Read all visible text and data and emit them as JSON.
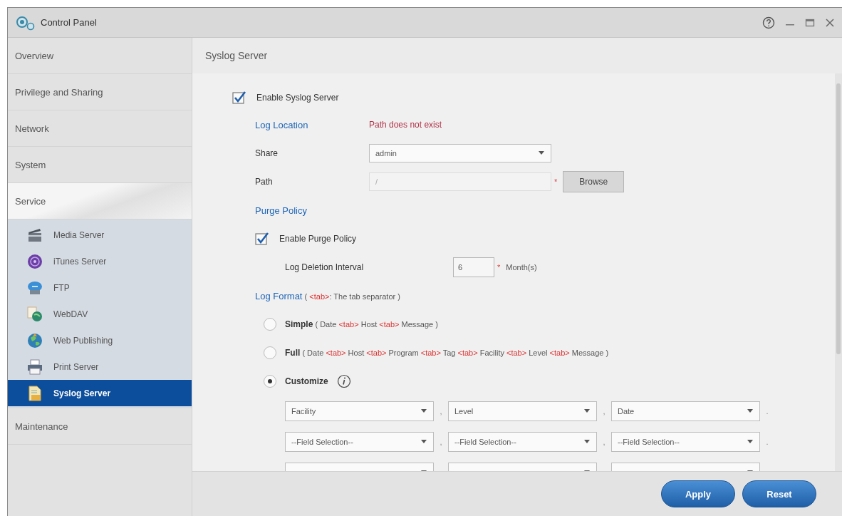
{
  "window": {
    "title": "Control Panel"
  },
  "sidebar": {
    "items": [
      {
        "label": "Overview",
        "expanded": false
      },
      {
        "label": "Privilege and Sharing",
        "expanded": false
      },
      {
        "label": "Network",
        "expanded": false
      },
      {
        "label": "System",
        "expanded": false
      },
      {
        "label": "Service",
        "expanded": true,
        "children": [
          {
            "label": "Media Server",
            "kind": "media",
            "selected": false
          },
          {
            "label": "iTunes Server",
            "kind": "music",
            "selected": false
          },
          {
            "label": "FTP",
            "kind": "ftp",
            "selected": false
          },
          {
            "label": "WebDAV",
            "kind": "webdav",
            "selected": false
          },
          {
            "label": "Web Publishing",
            "kind": "globe",
            "selected": false
          },
          {
            "label": "Print Server",
            "kind": "printer",
            "selected": false
          },
          {
            "label": "Syslog Server",
            "kind": "syslog",
            "selected": true
          }
        ]
      },
      {
        "label": "Maintenance",
        "expanded": false
      }
    ]
  },
  "content": {
    "title": "Syslog Server",
    "enable": {
      "label": "Enable Syslog Server",
      "checked": true
    },
    "log_location": {
      "heading": "Log Location",
      "error": "Path does not exist",
      "share": {
        "label": "Share",
        "value": "admin"
      },
      "path": {
        "label": "Path",
        "value": "/",
        "disabled": true,
        "required_mark": "*",
        "browse": "Browse"
      }
    },
    "purge_policy": {
      "heading": "Purge Policy",
      "enable": {
        "label": "Enable Purge Policy",
        "checked": true
      },
      "interval": {
        "label": "Log Deletion Interval",
        "value": "6",
        "required_mark": "*",
        "unit": "Month(s)"
      }
    },
    "log_format": {
      "heading": "Log Format",
      "note": [
        {
          "kind": "plain",
          "text": "( "
        },
        {
          "kind": "sep",
          "text": "<tab>"
        },
        {
          "kind": "plain",
          "text": ": The tab separator )"
        }
      ],
      "options": [
        {
          "label": "Simple",
          "selected": false,
          "description": [
            {
              "kind": "plain",
              "text": "( Date "
            },
            {
              "kind": "sep",
              "text": "<tab>"
            },
            {
              "kind": "plain",
              "text": " Host "
            },
            {
              "kind": "sep",
              "text": "<tab>"
            },
            {
              "kind": "plain",
              "text": " Message )"
            }
          ]
        },
        {
          "label": "Full",
          "selected": false,
          "description": [
            {
              "kind": "plain",
              "text": "( Date "
            },
            {
              "kind": "sep",
              "text": "<tab>"
            },
            {
              "kind": "plain",
              "text": " Host "
            },
            {
              "kind": "sep",
              "text": "<tab>"
            },
            {
              "kind": "plain",
              "text": " Program "
            },
            {
              "kind": "sep",
              "text": "<tab>"
            },
            {
              "kind": "plain",
              "text": " Tag "
            },
            {
              "kind": "sep",
              "text": "<tab>"
            },
            {
              "kind": "plain",
              "text": " Facility "
            },
            {
              "kind": "sep",
              "text": "<tab>"
            },
            {
              "kind": "plain",
              "text": " Level "
            },
            {
              "kind": "sep",
              "text": "<tab>"
            },
            {
              "kind": "plain",
              "text": " Message )"
            }
          ]
        },
        {
          "label": "Customize",
          "selected": true,
          "info": true
        }
      ],
      "fields": [
        [
          {
            "kind": "select",
            "value": "Facility",
            "after": ","
          },
          {
            "kind": "select",
            "value": "Level",
            "after": ","
          },
          {
            "kind": "select",
            "value": "Date",
            "after": "."
          }
        ],
        [
          {
            "kind": "select",
            "value": "--Field Selection--",
            "after": ","
          },
          {
            "kind": "select",
            "value": "--Field Selection--",
            "after": ","
          },
          {
            "kind": "select",
            "value": "--Field Selection--",
            "after": "."
          }
        ],
        [
          {
            "kind": "select"
          },
          {
            "kind": "select"
          },
          {
            "kind": "select"
          }
        ]
      ]
    }
  },
  "buttons": [
    {
      "label": "Apply"
    },
    {
      "label": "Reset"
    }
  ]
}
